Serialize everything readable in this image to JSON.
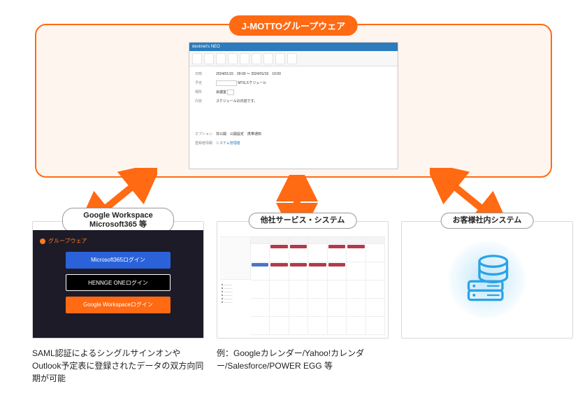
{
  "top": {
    "badge": "J-MOTTOグループウェア",
    "app_title": "desknet's NEO",
    "form": {
      "row1": {
        "label": "日時",
        "value": "2024/01/15　09:00 ～ 2024/01/15　10:00"
      },
      "row2": {
        "label": "予定",
        "value": "MTGスケジュール"
      },
      "row3": {
        "label": "場所",
        "value": "会議室"
      },
      "row4": {
        "label": "内容",
        "value": "スケジュールの内容です。"
      },
      "options_label": "オプション",
      "options_value": "非公開　公開設定　携帯通知",
      "registrant_label": "登録者情報",
      "registrant_value": "システム管理者"
    }
  },
  "cards": {
    "left": {
      "badge_line1": "Google Workspace",
      "badge_line2": "Microsoft365 等",
      "brand": "グループウェア",
      "btn1": "Microsoft365ログイン",
      "btn2": "HENNGE ONEログイン",
      "btn3": "Google Workspaceログイン"
    },
    "mid": {
      "badge": "他社サービス・システム"
    },
    "right": {
      "badge": "お客様社内システム"
    }
  },
  "captions": {
    "left": "SAML認証によるシングルサインオンやOutlook予定表に登録されたデータの双方向同期が可能",
    "mid": "例：Googleカレンダー/Yahoo!カレンダー/Salesforce/POWER EGG 等"
  },
  "colors": {
    "accent": "#ff6a13",
    "blue": "#2aa3e6"
  }
}
